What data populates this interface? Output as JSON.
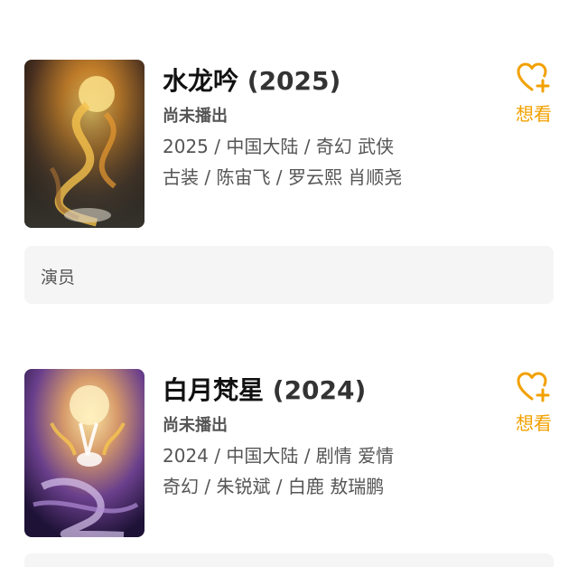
{
  "items": [
    {
      "title": "水龙吟",
      "year": "(2025)",
      "status": "尚未播出",
      "meta_line1": "2025 / 中国大陆 / 奇幻 武侠",
      "meta_line2": "古装 / 陈宙飞 / 罗云熙 肖顺尧",
      "want_label": "想看",
      "section_label": "演员",
      "poster_colors": [
        "#3a2a1a",
        "#c88a2a",
        "#f3c15a"
      ]
    },
    {
      "title": "白月梵星",
      "year": "(2024)",
      "status": "尚未播出",
      "meta_line1": "2024 / 中国大陆 / 剧情 爱情",
      "meta_line2": "奇幻 / 朱锐斌 / 白鹿 敖瑞鹏",
      "want_label": "想看",
      "poster_colors": [
        "#2a1c4a",
        "#8a5cb0",
        "#f6d58a"
      ]
    }
  ],
  "accent_color": "#f2a100",
  "icons": {
    "want": "heart-plus-icon"
  }
}
